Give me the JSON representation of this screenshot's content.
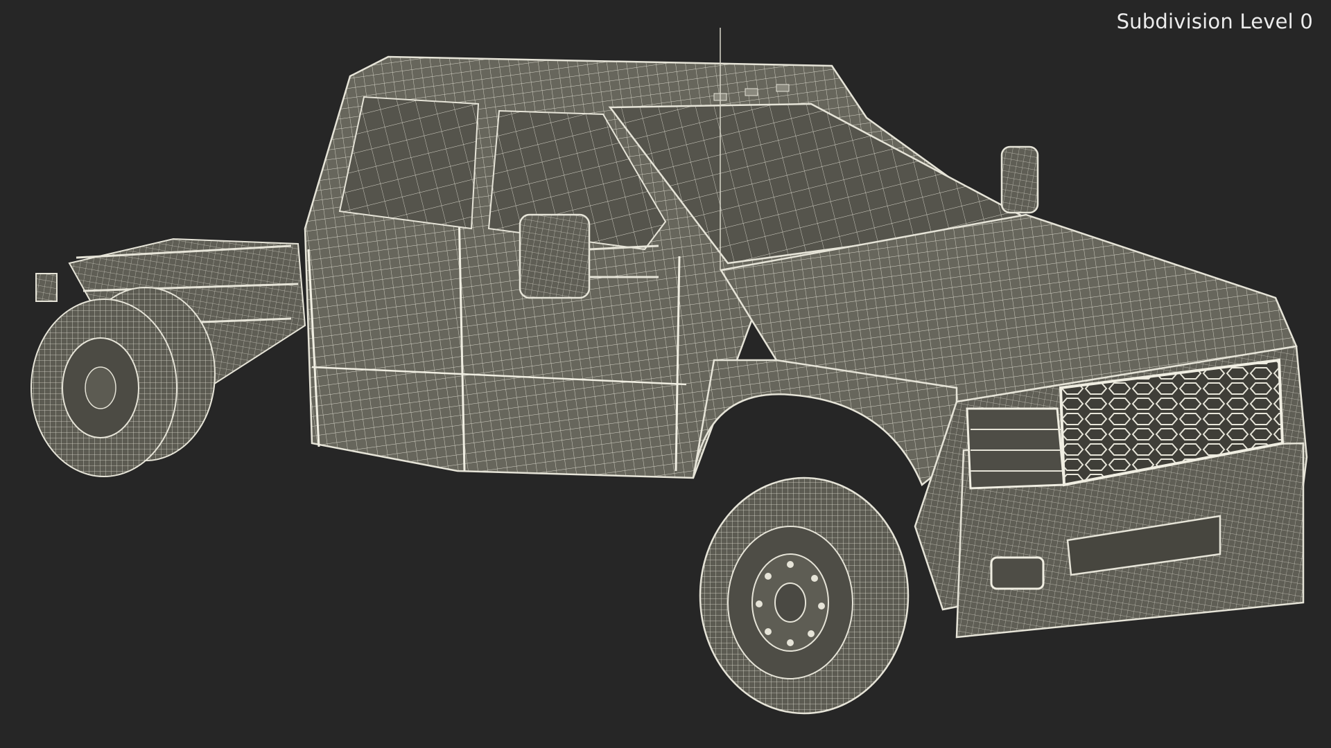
{
  "viewport": {
    "overlay_label": "Subdivision Level 0",
    "background_color": "#262626",
    "model_fill_color": "#6b6a60",
    "wire_color": "#e6e4d8",
    "subject": "pickup truck chassis cab wireframe render"
  }
}
